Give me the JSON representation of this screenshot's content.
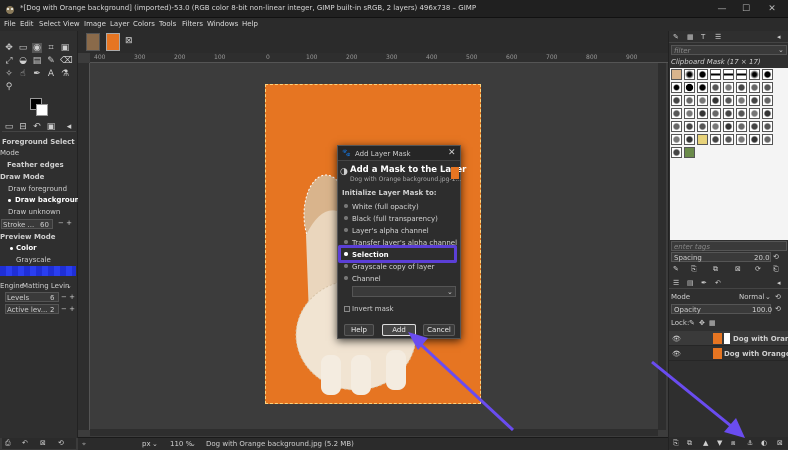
{
  "window": {
    "title": "*[Dog with Orange background] (imported)-53.0 (RGB color 8-bit non-linear integer, GIMP built-in sRGB, 2 layers) 496x738 – GIMP",
    "minimize": "—",
    "maximize": "☐",
    "close": "✕"
  },
  "menu": [
    "File",
    "Edit",
    "Select",
    "View",
    "Image",
    "Layer",
    "Colors",
    "Tools",
    "Filters",
    "Windows",
    "Help"
  ],
  "tool_options": {
    "title": "Foreground Select",
    "mode_label": "Mode",
    "feather": "Feather edges",
    "draw_mode_label": "Draw Mode",
    "draw_modes": [
      "Draw foreground",
      "Draw background",
      "Draw unknown"
    ],
    "stroke_label": "Stroke ...",
    "stroke_value": "60",
    "preview_mode_label": "Preview Mode",
    "preview_modes": [
      "Color",
      "Grayscale"
    ],
    "engine_label": "Engine",
    "engine_value": "Matting Levin",
    "levels_label": "Levels",
    "levels_value": "6",
    "active_label": "Active lev...",
    "active_value": "2"
  },
  "ruler": {
    "ticks": [
      "400",
      "300",
      "200",
      "100",
      "0",
      "100",
      "200",
      "300",
      "400",
      "500",
      "600",
      "700",
      "800",
      "900"
    ]
  },
  "status": {
    "unit": "px",
    "zoom": "110 %",
    "file": "Dog with Orange background.jpg (5.2 MB)"
  },
  "right": {
    "filter_placeholder": "filter",
    "brush_label": "Clipboard Mask (17 × 17)",
    "tags_placeholder": "enter tags",
    "spacing_label": "Spacing",
    "spacing_value": "20.0",
    "mode_label": "Mode",
    "mode_value": "Normal",
    "opacity_label": "Opacity",
    "opacity_value": "100.0",
    "lock_label": "Lock:",
    "layers": [
      {
        "name": "Dog with Orang"
      },
      {
        "name": "Dog with Orange b"
      }
    ]
  },
  "dialog": {
    "title": "Add Layer Mask",
    "heading": "Add a Mask to the Layer",
    "subheading": "Dog with Orange background.jpg-1...",
    "section": "Initialize Layer Mask to:",
    "options": [
      "White (full opacity)",
      "Black (full transparency)",
      "Layer's alpha channel",
      "Transfer layer's alpha channel",
      "Selection",
      "Grayscale copy of layer",
      "Channel"
    ],
    "selected": "Selection",
    "invert": "Invert mask",
    "help": "Help",
    "add": "Add",
    "cancel": "Cancel"
  },
  "colors": {
    "accent": "#5b3fd6",
    "photo_bg": "#e67522",
    "arrow": "#6a4cf0"
  }
}
